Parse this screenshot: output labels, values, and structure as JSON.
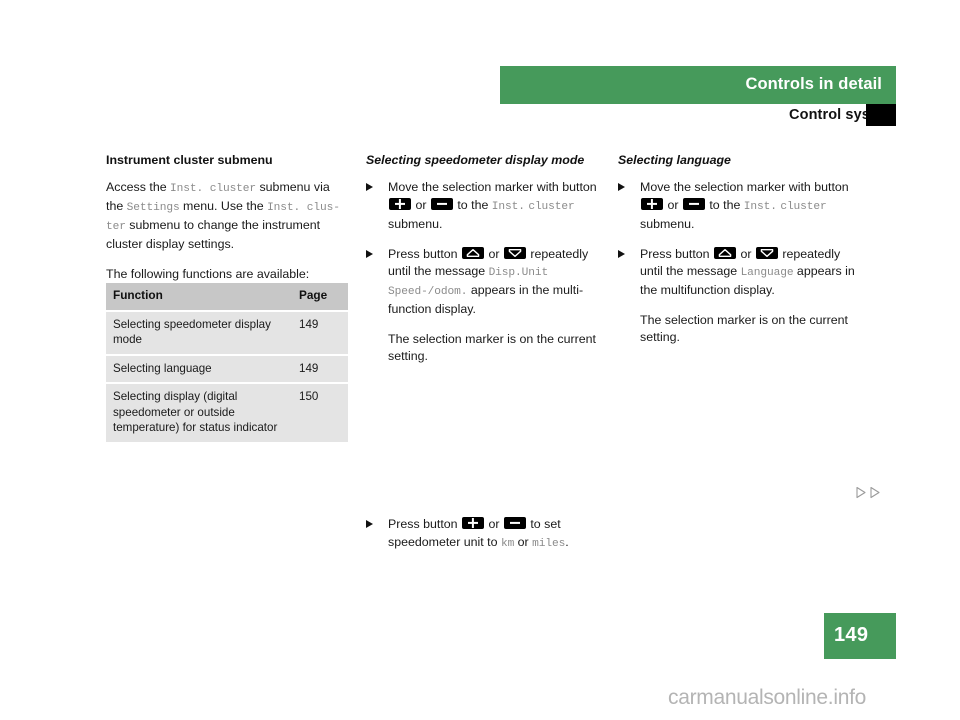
{
  "header": {
    "band_title": "Controls in detail",
    "subtitle": "Control system",
    "marker_icon": "black-square-marker"
  },
  "left_column": {
    "heading": "Instrument cluster submenu",
    "paragraph1": {
      "t1": "Access the ",
      "m1": "Inst. cluster",
      "t2": " submenu via the ",
      "m2": "Settings",
      "t3": " menu. Use the ",
      "m3": "Inst. clus-",
      "m4": "ter",
      "t4": " submenu to change the instrument cluster display settings."
    },
    "paragraph2": "The following functions are available:",
    "table": {
      "columns": [
        "Function",
        "Page"
      ],
      "rows": [
        {
          "function": "Selecting speedometer display mode",
          "page": "149"
        },
        {
          "function": "Selecting language",
          "page": "149"
        },
        {
          "function": "Selecting display (digital speedometer or outside temperature) for status indicator",
          "page": "150"
        }
      ]
    }
  },
  "middle_column": {
    "heading": "Selecting speedometer display mode",
    "bullet1": {
      "t1": "Move the selection marker with button ",
      "key1": "plus-button",
      "t2": " or ",
      "key2": "minus-button",
      "t3": " to the ",
      "m1": "Inst.",
      "m2": "cluster",
      "t4": " submenu."
    },
    "bullet2": {
      "t1": "Press button ",
      "key1": "up-arrow-button",
      "t2": " or ",
      "key2": "down-arrow-button",
      "t3": " repeatedly until the message ",
      "m1": "Disp.Unit",
      "m2": "Speed-/odom.",
      "t4": " appears in the multi-function display."
    },
    "note": "The selection marker is on the current setting."
  },
  "right_column": {
    "heading": "Selecting language",
    "bullet1": {
      "t1": "Move the selection marker with button ",
      "key1": "plus-button",
      "t2": " or ",
      "key2": "minus-button",
      "t3": " to the ",
      "m1": "Inst.",
      "m2": "cluster",
      "t4": " submenu."
    },
    "bullet2": {
      "t1": "Press button ",
      "key1": "up-arrow-button",
      "t2": " or ",
      "key2": "down-arrow-button",
      "t3": " repeatedly until the message ",
      "m1": "Language",
      "t4": " appears in the multifunction display."
    },
    "note": "The selection marker is on the current setting."
  },
  "bottom_bullet": {
    "t1": "Press button ",
    "key1": "plus-button",
    "t2": " or ",
    "key2": "minus-button",
    "t3": " to set speedometer unit to ",
    "m1": "km",
    "t4": " or ",
    "m2": "miles",
    "t5": "."
  },
  "continuation": {
    "icon": "double-right-triangle-icon"
  },
  "footer": {
    "page_number": "149",
    "watermark": "carmanualsonline.info"
  },
  "colors": {
    "brand_green": "#469a5b",
    "table_header_gray": "#c7c7c7",
    "table_row_gray": "#e4e4e4",
    "mono_gray": "#8b8b8b",
    "watermark_gray": "#b4b4b4"
  }
}
